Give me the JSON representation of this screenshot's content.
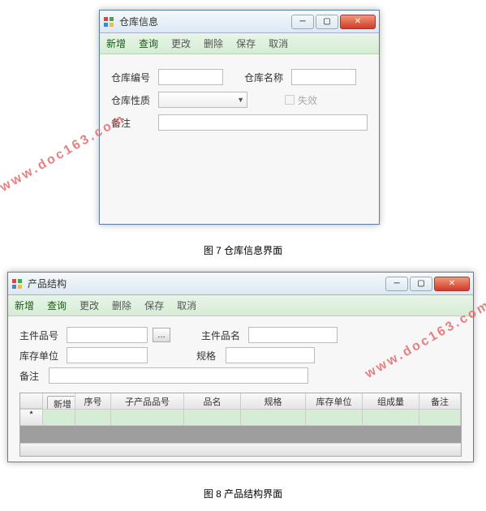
{
  "watermark": "www.doc163.com",
  "window1": {
    "title": "仓库信息",
    "menu": {
      "add": "新增",
      "query": "查询",
      "edit": "更改",
      "delete": "删除",
      "save": "保存",
      "cancel": "取消"
    },
    "labels": {
      "code": "仓库编号",
      "name": "仓库名称",
      "type": "仓库性质",
      "invalid": "失效",
      "remark": "备注"
    },
    "values": {
      "code": "",
      "name": "",
      "type": "",
      "remark": ""
    }
  },
  "caption1": "图 7  仓库信息界面",
  "window2": {
    "title": "产品结构",
    "menu": {
      "add": "新增",
      "query": "查询",
      "edit": "更改",
      "delete": "删除",
      "save": "保存",
      "cancel": "取消"
    },
    "labels": {
      "main_code": "主件品号",
      "main_name": "主件品名",
      "stock_unit": "库存单位",
      "spec": "规格",
      "remark": "备注"
    },
    "values": {
      "main_code": "",
      "main_name": "",
      "stock_unit": "",
      "spec": "",
      "remark": ""
    },
    "grid": {
      "row_btn": "新增",
      "row_marker": "*",
      "headers": {
        "seq": "序号",
        "sub_code": "子产品品号",
        "name": "品名",
        "spec": "规格",
        "unit": "库存单位",
        "qty": "组成量",
        "remark": "备注"
      }
    }
  },
  "caption2": "图 8  产品结构界面"
}
